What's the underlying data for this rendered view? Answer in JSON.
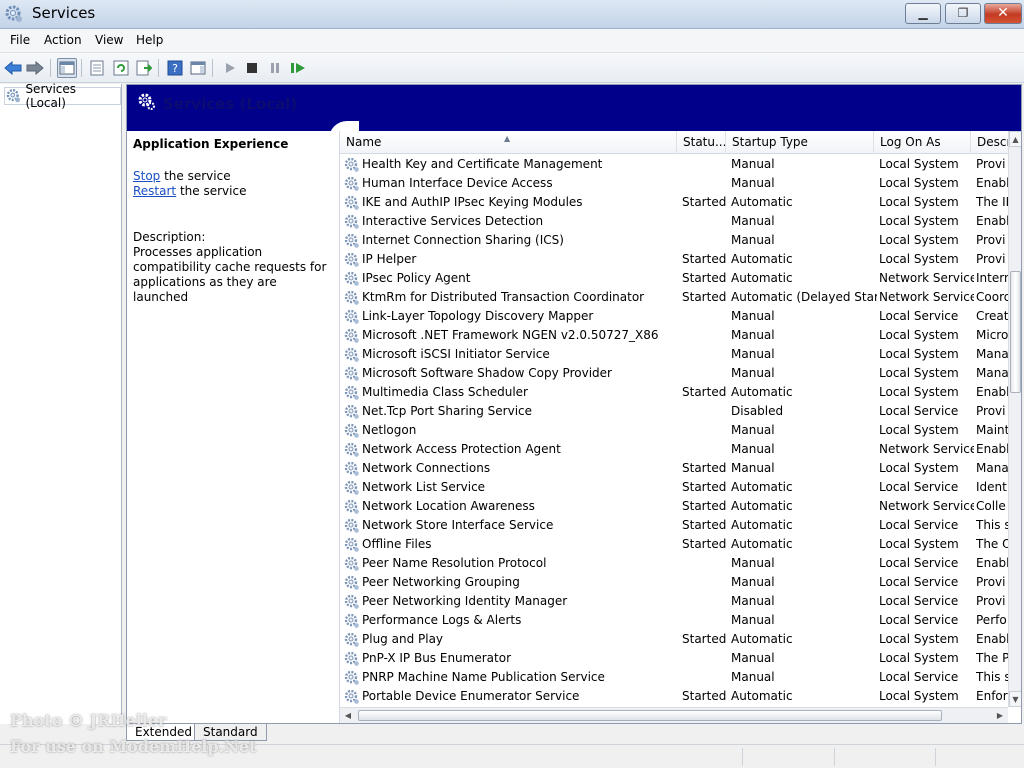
{
  "window": {
    "title": "Services"
  },
  "menu": {
    "items": [
      "File",
      "Action",
      "View",
      "Help"
    ]
  },
  "tree": {
    "root_label": "Services (Local)"
  },
  "banner": {
    "title": "Services (Local)",
    "color": "#00008b"
  },
  "extended": {
    "service_name": "Application Experience",
    "stop_link": "Stop",
    "stop_suffix": " the service",
    "restart_link": "Restart",
    "restart_suffix": " the service",
    "description_label": "Description:",
    "description": "Processes application compatibility cache requests for applications as they are launched"
  },
  "columns": {
    "name": "Name",
    "status": "Statu...",
    "startup": "Startup Type",
    "logon": "Log On As",
    "desc": "Descr"
  },
  "services": [
    {
      "name": "Health Key and Certificate Management",
      "status": "",
      "startup": "Manual",
      "logon": "Local System",
      "desc": "Provi"
    },
    {
      "name": "Human Interface Device Access",
      "status": "",
      "startup": "Manual",
      "logon": "Local System",
      "desc": "Enabl"
    },
    {
      "name": "IKE and AuthIP IPsec Keying Modules",
      "status": "Started",
      "startup": "Automatic",
      "logon": "Local System",
      "desc": "The IK"
    },
    {
      "name": "Interactive Services Detection",
      "status": "",
      "startup": "Manual",
      "logon": "Local System",
      "desc": "Enabl"
    },
    {
      "name": "Internet Connection Sharing (ICS)",
      "status": "",
      "startup": "Manual",
      "logon": "Local System",
      "desc": "Provi"
    },
    {
      "name": "IP Helper",
      "status": "Started",
      "startup": "Automatic",
      "logon": "Local System",
      "desc": "Provi"
    },
    {
      "name": "IPsec Policy Agent",
      "status": "Started",
      "startup": "Automatic",
      "logon": "Network Service",
      "desc": "Intern"
    },
    {
      "name": "KtmRm for Distributed Transaction Coordinator",
      "status": "Started",
      "startup": "Automatic (Delayed Start)",
      "logon": "Network Service",
      "desc": "Coord"
    },
    {
      "name": "Link-Layer Topology Discovery Mapper",
      "status": "",
      "startup": "Manual",
      "logon": "Local Service",
      "desc": "Creat"
    },
    {
      "name": "Microsoft .NET Framework NGEN v2.0.50727_X86",
      "status": "",
      "startup": "Manual",
      "logon": "Local System",
      "desc": "Micro"
    },
    {
      "name": "Microsoft iSCSI Initiator Service",
      "status": "",
      "startup": "Manual",
      "logon": "Local System",
      "desc": "Mana"
    },
    {
      "name": "Microsoft Software Shadow Copy Provider",
      "status": "",
      "startup": "Manual",
      "logon": "Local System",
      "desc": "Mana"
    },
    {
      "name": "Multimedia Class Scheduler",
      "status": "Started",
      "startup": "Automatic",
      "logon": "Local System",
      "desc": "Enabl"
    },
    {
      "name": "Net.Tcp Port Sharing Service",
      "status": "",
      "startup": "Disabled",
      "logon": "Local Service",
      "desc": "Provi"
    },
    {
      "name": "Netlogon",
      "status": "",
      "startup": "Manual",
      "logon": "Local System",
      "desc": "Maint"
    },
    {
      "name": "Network Access Protection Agent",
      "status": "",
      "startup": "Manual",
      "logon": "Network Service",
      "desc": "Enabl"
    },
    {
      "name": "Network Connections",
      "status": "Started",
      "startup": "Manual",
      "logon": "Local System",
      "desc": "Mana"
    },
    {
      "name": "Network List Service",
      "status": "Started",
      "startup": "Automatic",
      "logon": "Local Service",
      "desc": "Identi"
    },
    {
      "name": "Network Location Awareness",
      "status": "Started",
      "startup": "Automatic",
      "logon": "Network Service",
      "desc": "Colle"
    },
    {
      "name": "Network Store Interface Service",
      "status": "Started",
      "startup": "Automatic",
      "logon": "Local Service",
      "desc": "This s"
    },
    {
      "name": "Offline Files",
      "status": "Started",
      "startup": "Automatic",
      "logon": "Local System",
      "desc": "The O"
    },
    {
      "name": "Peer Name Resolution Protocol",
      "status": "",
      "startup": "Manual",
      "logon": "Local Service",
      "desc": "Enabl"
    },
    {
      "name": "Peer Networking Grouping",
      "status": "",
      "startup": "Manual",
      "logon": "Local Service",
      "desc": "Provi"
    },
    {
      "name": "Peer Networking Identity Manager",
      "status": "",
      "startup": "Manual",
      "logon": "Local Service",
      "desc": "Provi"
    },
    {
      "name": "Performance Logs & Alerts",
      "status": "",
      "startup": "Manual",
      "logon": "Local Service",
      "desc": "Perfo"
    },
    {
      "name": "Plug and Play",
      "status": "Started",
      "startup": "Automatic",
      "logon": "Local System",
      "desc": "Enabl"
    },
    {
      "name": "PnP-X IP Bus Enumerator",
      "status": "",
      "startup": "Manual",
      "logon": "Local System",
      "desc": "The P"
    },
    {
      "name": "PNRP Machine Name Publication Service",
      "status": "",
      "startup": "Manual",
      "logon": "Local Service",
      "desc": "This s"
    },
    {
      "name": "Portable Device Enumerator Service",
      "status": "Started",
      "startup": "Automatic",
      "logon": "Local System",
      "desc": "Enfor"
    }
  ],
  "tabs": {
    "extended": "Extended",
    "standard": "Standard"
  },
  "watermark": {
    "line1": "Photo © JRHeller",
    "line2": "For use on ModemHelp.Net"
  }
}
